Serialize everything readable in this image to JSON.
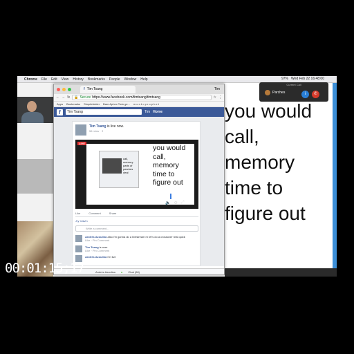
{
  "timecode": "00:01:15;17",
  "menubar": {
    "app": "Chrome",
    "items": [
      "File",
      "Edit",
      "View",
      "History",
      "Bookmarks",
      "People",
      "Window",
      "Help"
    ],
    "clock": "Wed Feb 22  16:48:00",
    "battery": "97%"
  },
  "call": {
    "header": "Current Call",
    "name": "Parches",
    "info_icon": "info-icon",
    "end_icon": "end-call-icon"
  },
  "big_text": [
    "you would",
    "call,",
    "memory",
    "time to",
    "figure out"
  ],
  "browser": {
    "tab_title": "Tim Tsang",
    "tab2": "Tim",
    "secure": "Secure",
    "url": "https://www.facebook.com/timtsang/timtsang",
    "bookmarks": [
      "Apps",
      "Bookmarks",
      "SimpleAdder",
      "Bare Aphex Twin ge...",
      "m o n k • p r o p h e t"
    ],
    "fb": {
      "search_value": "Tim Tsang",
      "user": "Tim",
      "home": "Home",
      "post_name": "Tim Tsang",
      "post_suffix": " is live now.",
      "post_time": "56 mins · ✦",
      "live": "LIVE",
      "video_text": [
        "you would",
        "call,",
        "memory",
        "time to",
        "figure out"
      ],
      "mini_text": "call, memory parts of parches deal",
      "actions": [
        "Like",
        "Comment",
        "Share"
      ],
      "likes": "Jry Calvin",
      "comment_placeholder": "Write a comment...",
      "comments": [
        {
          "name": "Andrés Azoulina",
          "text": " also i'm gonna do a livestream rn let's do a crossover real quick",
          "sub": "Like · Pin Comment"
        },
        {
          "name": "Tim Tsang",
          "text": " is over",
          "sub": "Like · Pin Comment"
        },
        {
          "name": "Andrés Azoulina",
          "text": " i'm live",
          "sub": ""
        }
      ],
      "chat_name": "Andrés Azoulina",
      "chat_label": "Chat (66)"
    }
  }
}
